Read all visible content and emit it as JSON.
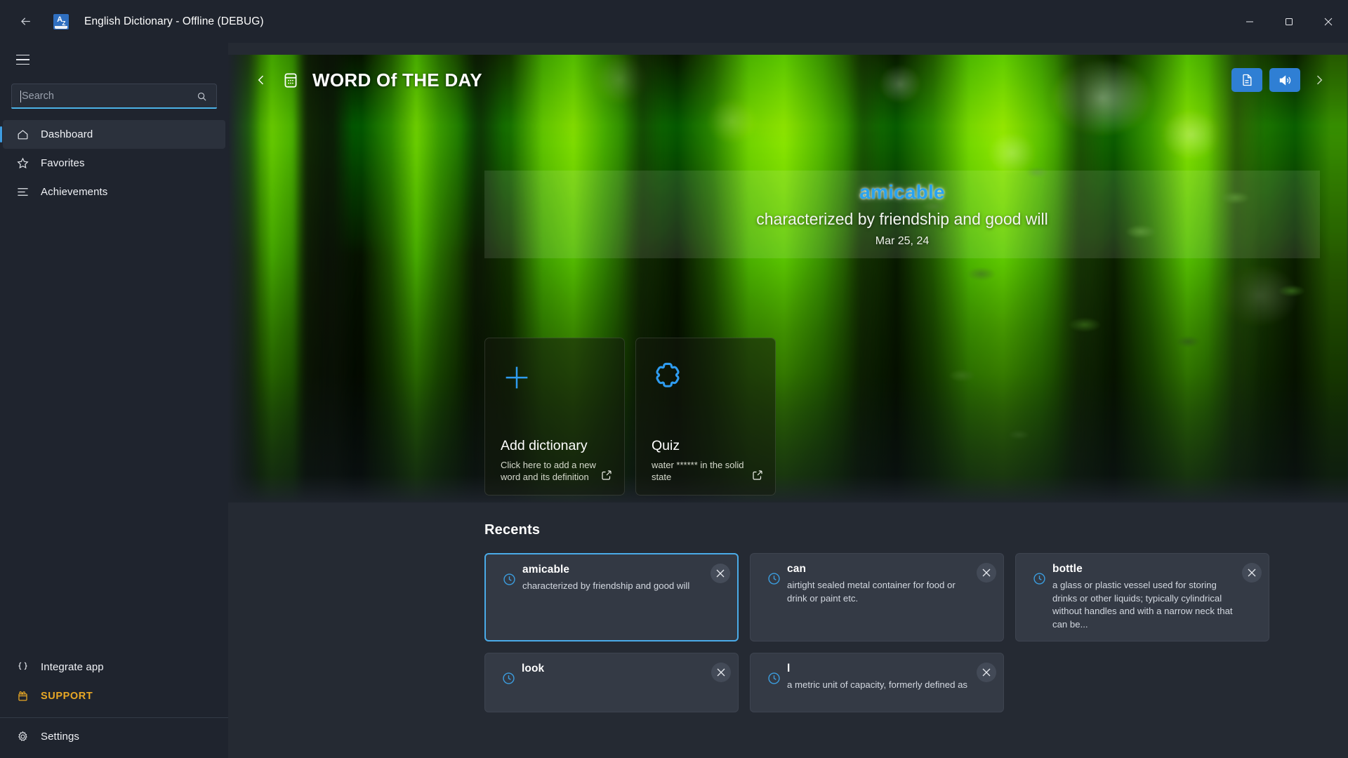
{
  "titlebar": {
    "back_label": "Back",
    "app_icon": "dictionary-book-icon",
    "app_icon_text": "A",
    "app_icon_sub": "Z",
    "title": "English Dictionary - Offline (DEBUG)",
    "minimize_label": "Minimize",
    "maximize_label": "Maximize",
    "close_label": "Close"
  },
  "sidebar": {
    "menu_label": "Menu",
    "search": {
      "value": "",
      "placeholder": "Search",
      "button_label": "Search"
    },
    "items": [
      {
        "label": "Dashboard",
        "icon": "home-icon",
        "selected": true
      },
      {
        "label": "Favorites",
        "icon": "star-icon",
        "selected": false
      },
      {
        "label": "Achievements",
        "icon": "list-icon",
        "selected": false
      }
    ],
    "bottom_items": [
      {
        "label": "Integrate app",
        "icon": "braces-icon"
      },
      {
        "label": "SUPPORT",
        "icon": "gift-icon",
        "accent": "#e9a825"
      },
      {
        "label": "Settings",
        "icon": "gear-icon"
      }
    ]
  },
  "hero": {
    "back_label": "Previous",
    "calendar_icon": "calendar-icon",
    "title": "WORD Of THE DAY",
    "next_label": "Next",
    "actions": [
      {
        "name": "definition-button",
        "icon": "document-icon"
      },
      {
        "name": "pronounce-button",
        "icon": "speaker-icon"
      }
    ],
    "word": "amicable",
    "definition": "characterized by friendship and good will",
    "date": "Mar 25, 24"
  },
  "tiles": [
    {
      "icon": "plus-icon",
      "title": "Add dictionary",
      "subtitle": "Click here to add a new word and its definition",
      "open_icon": "external-link-icon"
    },
    {
      "icon": "puzzle-icon",
      "title": "Quiz",
      "subtitle": "water ****** in the solid state",
      "open_icon": "external-link-icon"
    }
  ],
  "recents": {
    "title": "Recents",
    "items": [
      {
        "word": "amicable",
        "definition": "characterized by friendship and good will",
        "icon": "clock-icon",
        "close_label": "Remove",
        "selected": true
      },
      {
        "word": "can",
        "definition": "airtight sealed metal container for food or drink or paint etc.",
        "icon": "clock-icon",
        "close_label": "Remove",
        "selected": false
      },
      {
        "word": "bottle",
        "definition": "a glass or plastic vessel used for storing drinks or other liquids; typically cylindrical without handles and with a narrow neck that can be...",
        "icon": "clock-icon",
        "close_label": "Remove",
        "selected": false
      },
      {
        "word": "look",
        "definition": "",
        "icon": "clock-icon",
        "close_label": "Remove",
        "selected": false
      },
      {
        "word": "l",
        "definition": "a metric unit of capacity, formerly defined as",
        "icon": "clock-icon",
        "close_label": "Remove",
        "selected": false
      }
    ]
  },
  "colors": {
    "accent_blue": "#2f9cf0",
    "support_gold": "#e9a825",
    "window_bg": "#1f242e",
    "content_bg": "#252a33"
  }
}
